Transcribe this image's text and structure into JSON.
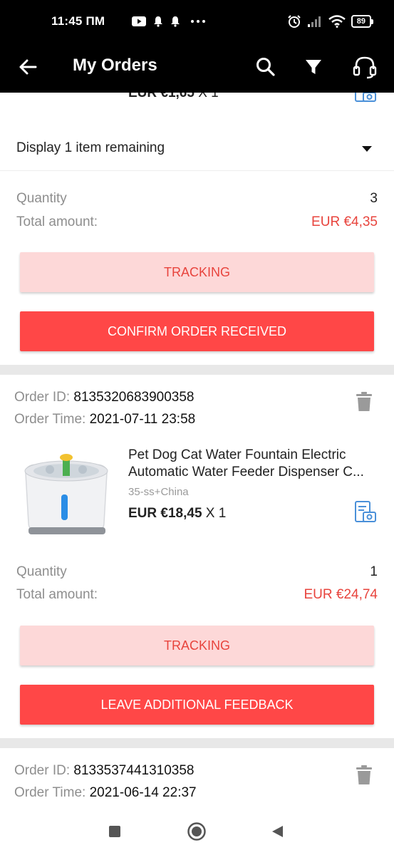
{
  "status_bar": {
    "time": "11:45 ПМ",
    "icons": [
      "youtube-icon",
      "bell-icon",
      "bell-icon",
      "more-icon",
      "alarm-icon",
      "signal-icon",
      "wifi-icon"
    ],
    "battery": "89"
  },
  "app_bar": {
    "title": "My Orders",
    "actions": [
      "search-icon",
      "filter-icon",
      "headset-icon"
    ]
  },
  "order_prev": {
    "price_partial": "EUR €1,65",
    "qty_partial": "X 1",
    "display_remaining": "Display 1 item remaining",
    "quantity_label": "Quantity",
    "quantity_value": "3",
    "total_label": "Total amount:",
    "total_value": "EUR €4,35",
    "btn_tracking": "TRACKING",
    "btn_confirm": "CONFIRM ORDER RECEIVED"
  },
  "order_2": {
    "order_id_label": "Order ID:",
    "order_id": "8135320683900358",
    "order_time_label": "Order Time:",
    "order_time": "2021-07-11 23:58",
    "product_title": "Pet Dog Cat Water Fountain Electric Automatic Water Feeder Dispenser C...",
    "variant": "35-ss+China",
    "price": "EUR €18,45",
    "qty": "X 1",
    "quantity_label": "Quantity",
    "quantity_value": "1",
    "total_label": "Total amount:",
    "total_value": "EUR €24,74",
    "btn_tracking": "TRACKING",
    "btn_feedback": "LEAVE ADDITIONAL FEEDBACK"
  },
  "order_3": {
    "order_id_label": "Order ID:",
    "order_id": "8133537441310358",
    "order_time_label": "Order Time:",
    "order_time": "2021-06-14 22:37"
  },
  "colors": {
    "accent_red": "#ff4747",
    "price_red": "#e8443d",
    "light_red": "#fdd8d8",
    "link_blue": "#4a90d9"
  }
}
